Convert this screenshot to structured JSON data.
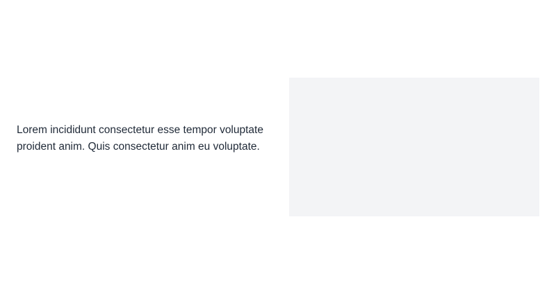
{
  "section": {
    "body_text": "Lorem incididunt consectetur esse tempor voluptate proident anim. Quis consectetur anim eu voluptate.",
    "media_placeholder_color": "#f3f4f6"
  }
}
